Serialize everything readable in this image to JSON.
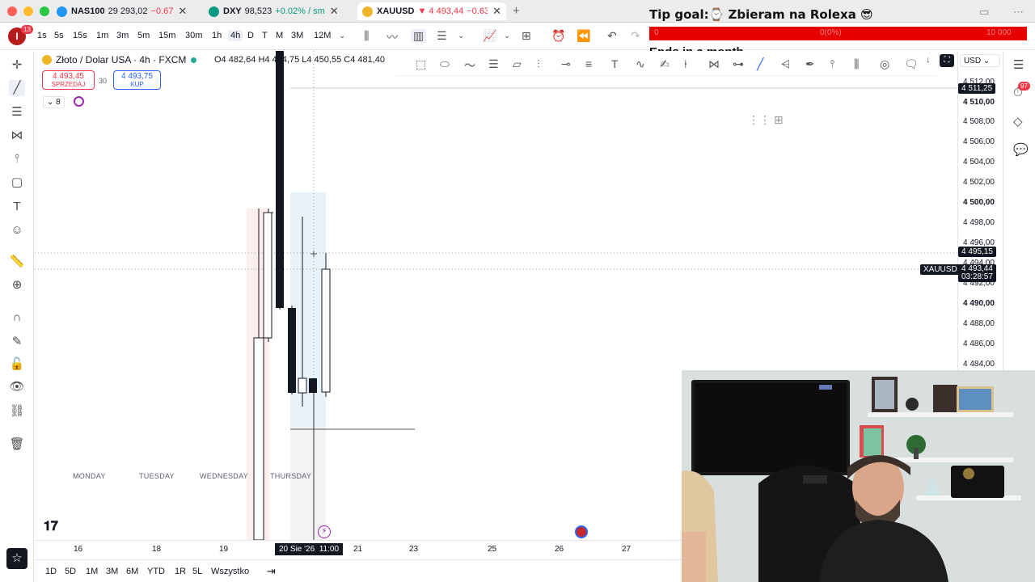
{
  "browser": {
    "tabs": [
      {
        "symbol": "NAS100",
        "value": "29 293,02",
        "change": "−0.67",
        "icon_color": "#2196f3",
        "active": false
      },
      {
        "symbol": "DXY",
        "value": "98,523",
        "change": "+0.02% / sm",
        "icon_color": "#089981",
        "active": false
      },
      {
        "symbol": "XAUUSD",
        "value": "▼ 4 493,44",
        "change": "−0.63",
        "icon_color": "#f0b429",
        "active": true
      }
    ]
  },
  "toolbar": {
    "avatar_letter": "I",
    "notification_count": "13",
    "intervals": [
      "1s",
      "5s",
      "15s",
      "1m",
      "3m",
      "5m",
      "15m",
      "30m",
      "1h",
      "4h",
      "D",
      "T",
      "M",
      "3M",
      "12M"
    ],
    "selected_interval": "4h"
  },
  "overlay": {
    "tip_goal": "Tip goal:⌚ Zbieram na Rolexa 😎",
    "progress_left": "0",
    "progress_center": "0(0%)",
    "progress_right": "10 000",
    "progress_fraction": 0.0,
    "ends": "Ends in a month"
  },
  "symbol": {
    "name": "Złoto / Dolar USA · 4h · FXCM",
    "open": "O4 482,64",
    "high": "H4 494,75",
    "low": "L4 450,55",
    "close": "C4 481,40",
    "sell_price": "4 493,45",
    "sell_label": "SPRZEDAJ",
    "spread": "30",
    "buy_price": "4 493,75",
    "buy_label": "KUP",
    "indicator_count": "8"
  },
  "price_scale": {
    "currency": "USD",
    "labels": [
      "4 512,00",
      "4 510,00",
      "4 508,00",
      "4 506,00",
      "4 504,00",
      "4 502,00",
      "4 500,00",
      "4 498,00",
      "4 496,00",
      "4 494,00",
      "4 492,00",
      "4 490,00",
      "4 488,00",
      "4 486,00",
      "4 484,00"
    ],
    "bold_labels": [
      "4 510,00",
      "4 500,00",
      "4 490,00"
    ],
    "crosshair_tag": "4 511,25",
    "hover_tag": "4 495,15",
    "last_price_tag": "4 493,44",
    "countdown": "03:28:57",
    "symbol_tag": "XAUUSD"
  },
  "right_sidebar": {
    "alerts_badge": "97"
  },
  "time_axis": {
    "labels": [
      "16",
      "18",
      "19",
      "21",
      "23",
      "25",
      "26",
      "27"
    ],
    "selected_date": "20 Sie '26",
    "selected_time": "11:00"
  },
  "day_labels": [
    "MONDAY",
    "TUESDAY",
    "WEDNESDAY",
    "THURSDAY"
  ],
  "ranges": [
    "1D",
    "5D",
    "1M",
    "3M",
    "6M",
    "YTD",
    "1R",
    "5L",
    "Wszystko"
  ],
  "colors": {
    "up": "#089981",
    "down": "#f23645",
    "accent": "#2962ff",
    "goal_bar": "#e60000"
  }
}
